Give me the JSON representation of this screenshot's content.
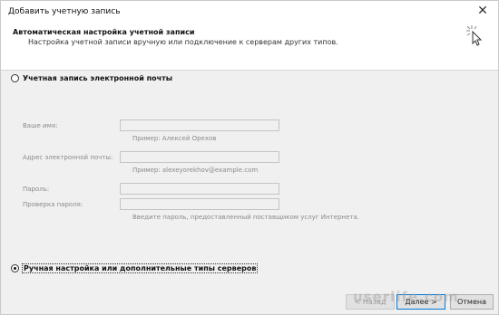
{
  "window": {
    "title": "Добавить учетную запись",
    "close_glyph": "✕"
  },
  "header": {
    "title": "Автоматическая настройка учетной записи",
    "subtitle": "Настройка учетной записи вручную или подключение к серверам других типов."
  },
  "options": {
    "email_account": {
      "label": "Учетная запись электронной почты",
      "checked": false
    },
    "manual_setup": {
      "label": "Ручная настройка или дополнительные типы серверов",
      "checked": true
    }
  },
  "form": {
    "name_label": "Ваше имя:",
    "name_value": "",
    "name_hint": "Пример: Алексей Орехов",
    "email_label": "Адрес электронной почты:",
    "email_value": "",
    "email_hint": "Пример: alexeyorekhov@example.com",
    "password_label": "Пароль:",
    "password_value": "",
    "confirm_label": "Проверка пароля:",
    "confirm_value": "",
    "password_hint": "Введите пароль, предоставленный поставщиком услуг Интернета."
  },
  "buttons": {
    "back": "< Назад",
    "next": "Далее >",
    "cancel": "Отмена"
  },
  "watermark": "userlife.com"
}
